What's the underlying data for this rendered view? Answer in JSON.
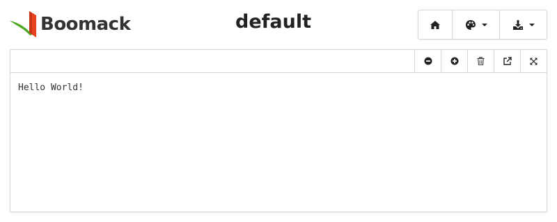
{
  "header": {
    "logo_text": "Boomack",
    "page_title": "default"
  },
  "toolbar": {
    "buttons": [
      {
        "icon": "home-icon"
      },
      {
        "icon": "palette-icon",
        "dropdown": true
      },
      {
        "icon": "download-icon",
        "dropdown": true
      }
    ]
  },
  "panel": {
    "tools": [
      {
        "icon": "zoom-out-icon"
      },
      {
        "icon": "zoom-in-icon"
      },
      {
        "icon": "trash-icon"
      },
      {
        "icon": "external-link-icon"
      },
      {
        "icon": "expand-icon"
      }
    ],
    "content_text": "Hello World!"
  },
  "colors": {
    "logo_green": "#5cb82a",
    "logo_red": "#e8421f",
    "border": "#d6d6d6"
  }
}
